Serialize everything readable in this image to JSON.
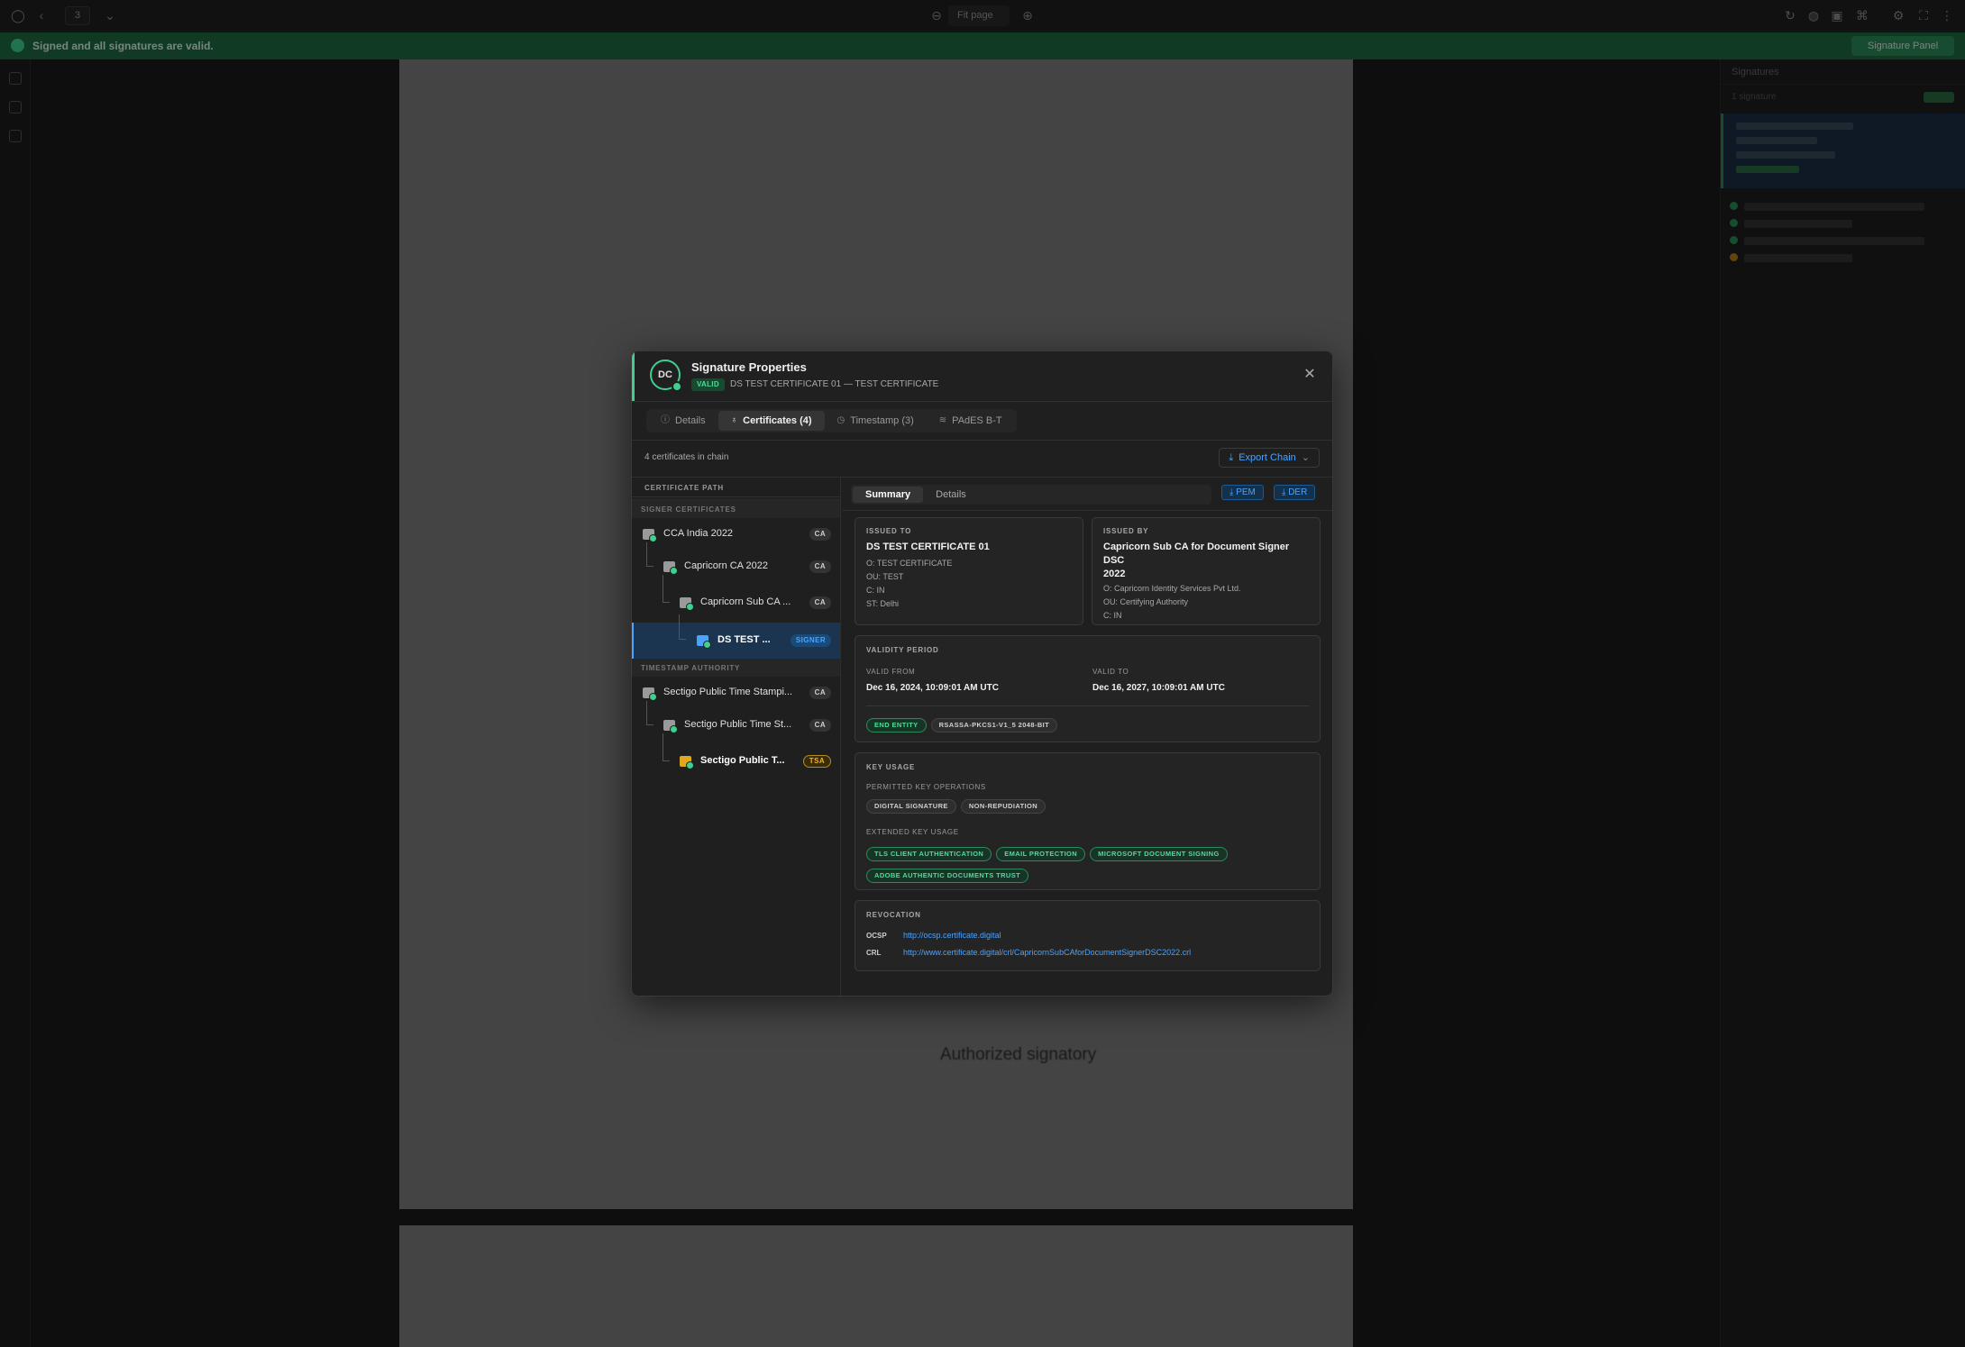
{
  "app": {
    "zoom_label": "Fit page",
    "page_number": "3",
    "banner_text": "Signed and all signatures are valid.",
    "banner_button": "Signature Panel",
    "document_text": "Authorized signatory"
  },
  "right_panel": {
    "title": "Signatures",
    "subtitle": "1 signature",
    "status_badge": "1 Valid"
  },
  "modal": {
    "avatar_initials": "DC",
    "title": "Signature Properties",
    "status_badge": "VALID",
    "subtitle": "DS TEST CERTIFICATE 01 — TEST CERTIFICATE",
    "close_icon": "close-icon",
    "tabs": [
      {
        "label": "Details",
        "icon": "info-icon"
      },
      {
        "label": "Certificates (4)",
        "icon": "ribbon-icon"
      },
      {
        "label": "Timestamp (3)",
        "icon": "clock-icon"
      },
      {
        "label": "PAdES B-T",
        "icon": "layers-icon"
      }
    ],
    "active_tab": "Certificates (4)",
    "chain_count": "4 certificates in chain",
    "export_button": "Export Chain",
    "path_title": "CERTIFICATE PATH",
    "groups": {
      "signer": "SIGNER CERTIFICATES",
      "tsa": "TIMESTAMP AUTHORITY"
    },
    "signer_chain": [
      {
        "label": "CCA India 2022",
        "badge": "CA"
      },
      {
        "label": "Capricorn CA 2022",
        "badge": "CA"
      },
      {
        "label": "Capricorn Sub CA ...",
        "badge": "CA"
      },
      {
        "label": "DS TEST ...",
        "badge": "SIGNER"
      }
    ],
    "tsa_chain": [
      {
        "label": "Sectigo Public Time Stampi...",
        "badge": "CA"
      },
      {
        "label": "Sectigo Public Time St...",
        "badge": "CA"
      },
      {
        "label": "Sectigo Public T...",
        "badge": "TSA"
      }
    ],
    "detail_tabs": [
      "Summary",
      "Details"
    ],
    "active_detail_tab": "Summary",
    "pem_button": "PEM",
    "der_button": "DER",
    "issued_to": {
      "heading": "ISSUED TO",
      "name": "DS TEST CERTIFICATE 01",
      "attrs": [
        "O: TEST CERTIFICATE",
        "OU: TEST",
        "C: IN",
        "ST: Delhi"
      ]
    },
    "issued_by": {
      "heading": "ISSUED BY",
      "name_line1": "Capricorn Sub CA for Document Signer DSC",
      "name_line2": "2022",
      "attrs": [
        "O: Capricorn Identity Services Pvt Ltd.",
        "OU: Certifying Authority",
        "C: IN"
      ]
    },
    "validity": {
      "heading": "VALIDITY PERIOD",
      "from_label": "VALID FROM",
      "from_value": "Dec 16, 2024, 10:09:01 AM UTC",
      "to_label": "VALID TO",
      "to_value": "Dec 16, 2027, 10:09:01 AM UTC",
      "tags": [
        "END ENTITY",
        "RSASSA-PKCS1-V1_5 2048-BIT"
      ]
    },
    "key_usage": {
      "heading": "KEY USAGE",
      "permitted_label": "PERMITTED KEY OPERATIONS",
      "permitted": [
        "DIGITAL SIGNATURE",
        "NON-REPUDIATION"
      ],
      "extended_label": "EXTENDED KEY USAGE",
      "extended": [
        "TLS CLIENT AUTHENTICATION",
        "EMAIL PROTECTION",
        "MICROSOFT DOCUMENT SIGNING",
        "ADOBE AUTHENTIC DOCUMENTS TRUST"
      ]
    },
    "revocation": {
      "heading": "REVOCATION",
      "ocsp_label": "OCSP",
      "ocsp_url": "http://ocsp.certificate.digital",
      "crl_label": "CRL",
      "crl_url": "http://www.certificate.digital/crl/CapricornSubCAforDocumentSignerDSC2022.crl"
    },
    "colors": {
      "valid_green": "#3fcf8e",
      "link_blue": "#4aa3ff",
      "tsa_gold": "#f0b429"
    }
  }
}
